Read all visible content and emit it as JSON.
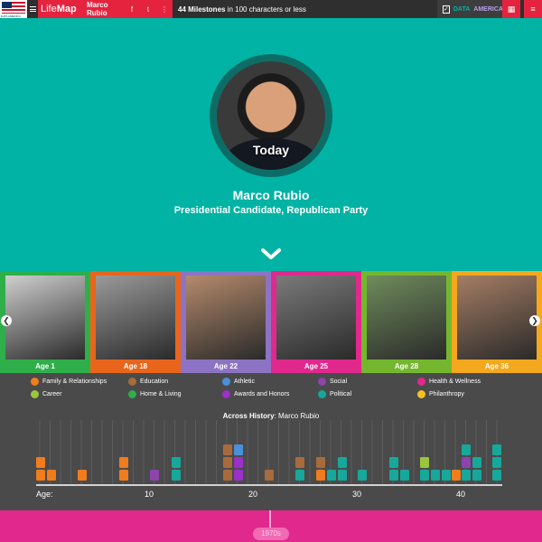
{
  "topbar": {
    "flag_caption": "DATA AMERICA",
    "brand_light": "Life",
    "brand_bold": "Map",
    "person": "Marco Rubio",
    "social_icons": [
      "facebook-icon",
      "twitter-icon",
      "more-icon"
    ],
    "social_glyphs": [
      "f",
      "t",
      "⋮"
    ],
    "milestones_count": "44 Milestones",
    "milestones_text": " in 100 characters or less",
    "check_glyph": "✓",
    "da_word1": "DATA",
    "da_word2": "AMERICA",
    "grid_glyph": "▦",
    "list_glyph": "≡"
  },
  "hero": {
    "badge": "Today",
    "name": "Marco Rubio",
    "title": "Presidential Candidate, Republican Party"
  },
  "strip": {
    "prev_glyph": "❮",
    "next_glyph": "❯",
    "cards": [
      {
        "label": "Age 1",
        "color": "#2eaf4a"
      },
      {
        "label": "Age 18",
        "color": "#e8651b"
      },
      {
        "label": "Age 22",
        "color": "#8d73c4"
      },
      {
        "label": "Age 25",
        "color": "#e1288d"
      },
      {
        "label": "Age 28",
        "color": "#74b72e"
      },
      {
        "label": "Age 36",
        "color": "#f4a81d"
      }
    ]
  },
  "legend": [
    {
      "label": "Family & Relationships",
      "color": "#f07c1b",
      "icon": "family-icon"
    },
    {
      "label": "Education",
      "color": "#a86b3c",
      "icon": "education-icon"
    },
    {
      "label": "Athletic",
      "color": "#4a90d9",
      "icon": "athletic-icon"
    },
    {
      "label": "Social",
      "color": "#8e44ad",
      "icon": "social-icon"
    },
    {
      "label": "Health & Wellness",
      "color": "#e1288d",
      "icon": "health-icon"
    },
    {
      "label": "Career",
      "color": "#9bc53d",
      "icon": "career-icon"
    },
    {
      "label": "Home & Living",
      "color": "#2eaf4a",
      "icon": "home-icon"
    },
    {
      "label": "Awards and Honors",
      "color": "#9b30c8",
      "icon": "award-icon"
    },
    {
      "label": "Political",
      "color": "#16a89b",
      "icon": "political-icon"
    },
    {
      "label": "Philanthropy",
      "color": "#f4c21d",
      "icon": "philanthropy-icon"
    }
  ],
  "timeline": {
    "heading_bold": "Across History",
    "heading_rest": ": Marco Rubio",
    "age_label": "Age:",
    "ticks": [
      "10",
      "20",
      "30",
      "40"
    ]
  },
  "bottom": {
    "decade": "1970s"
  }
}
